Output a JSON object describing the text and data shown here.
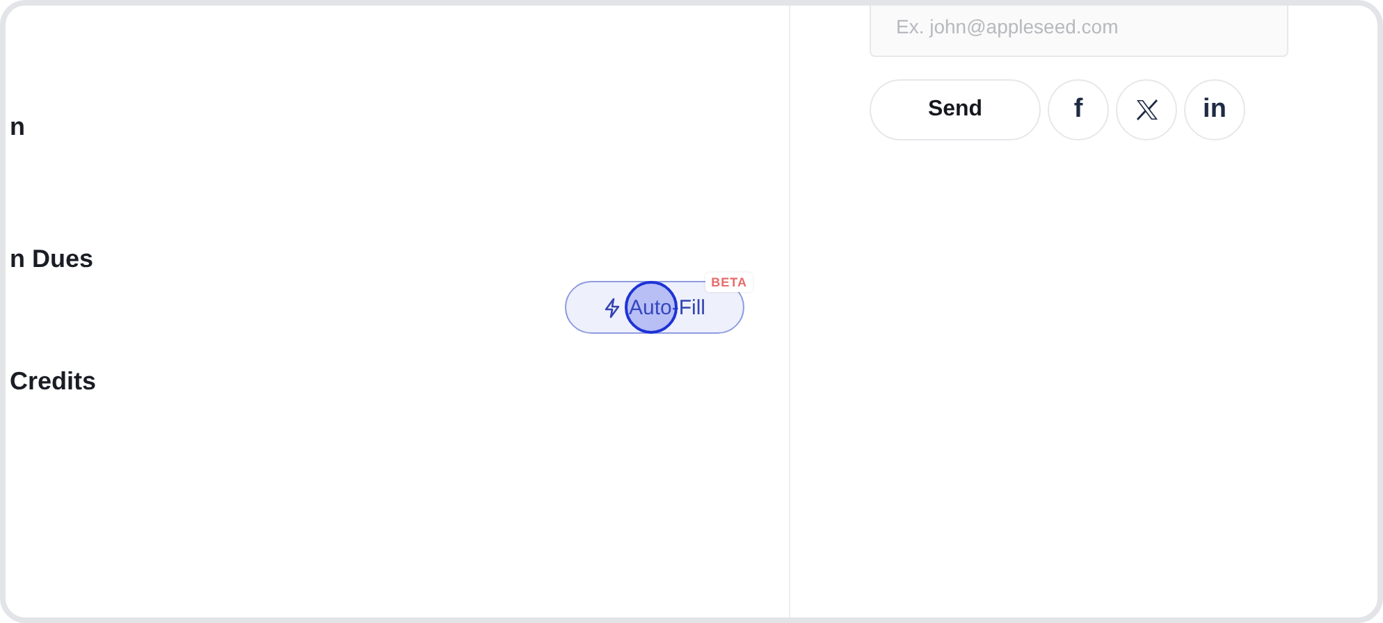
{
  "left_panel": {
    "labels": [
      "n",
      "n Dues",
      "Credits"
    ],
    "autofill": {
      "label": "Auto-Fill",
      "badge": "BETA"
    }
  },
  "right_panel": {
    "email_field": {
      "placeholder": "Ex. john@appleseed.com"
    },
    "send_button": "Send",
    "social_buttons": [
      {
        "kind": "facebook",
        "label": "f"
      },
      {
        "kind": "x"
      },
      {
        "kind": "linkedin",
        "label": "in"
      }
    ]
  }
}
